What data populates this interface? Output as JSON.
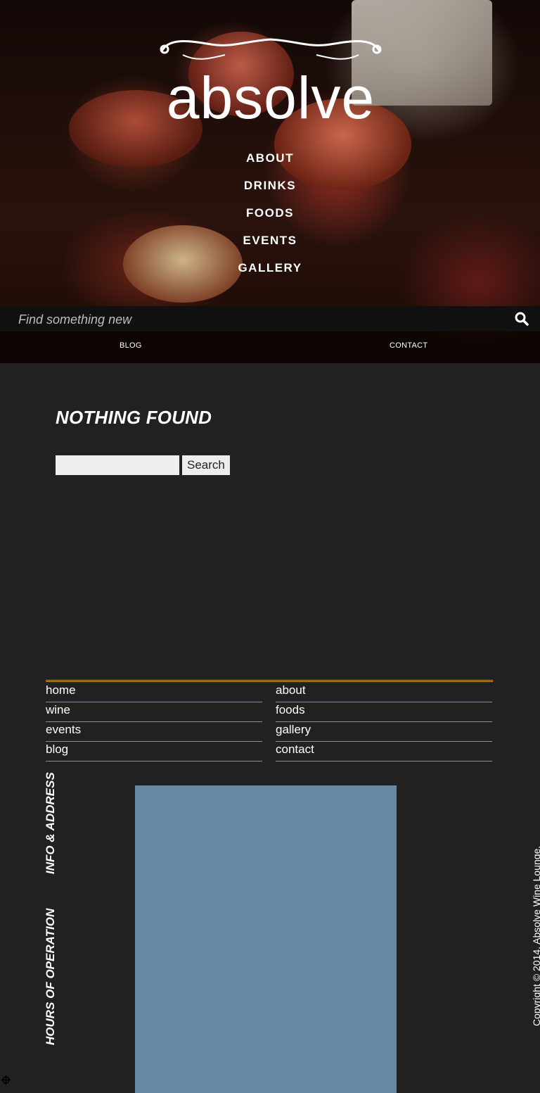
{
  "brand": {
    "logo_text": "absolve"
  },
  "nav": {
    "items": [
      "ABOUT",
      "DRINKS",
      "FOODS",
      "EVENTS",
      "GALLERY"
    ]
  },
  "search_bar": {
    "placeholder": "Find something new"
  },
  "subnav": {
    "blog": "BLOG",
    "contact": "CONTACT"
  },
  "main": {
    "title": "NOTHING FOUND",
    "search_button": "Search"
  },
  "footer": {
    "left_links": [
      "home",
      "wine",
      "events",
      "blog"
    ],
    "right_links": [
      "about",
      "foods",
      "gallery",
      "contact"
    ],
    "info_heading": "INFO & ADDRESS",
    "hours_heading": "HOURS OF OPERATION",
    "copyright": "Copyright © 2014. Absolve Wine Lounge."
  },
  "colors": {
    "background": "#212121",
    "accent_rule": "#c9a227",
    "map": "#678aa4",
    "link_rule": "#7f8fa6"
  }
}
